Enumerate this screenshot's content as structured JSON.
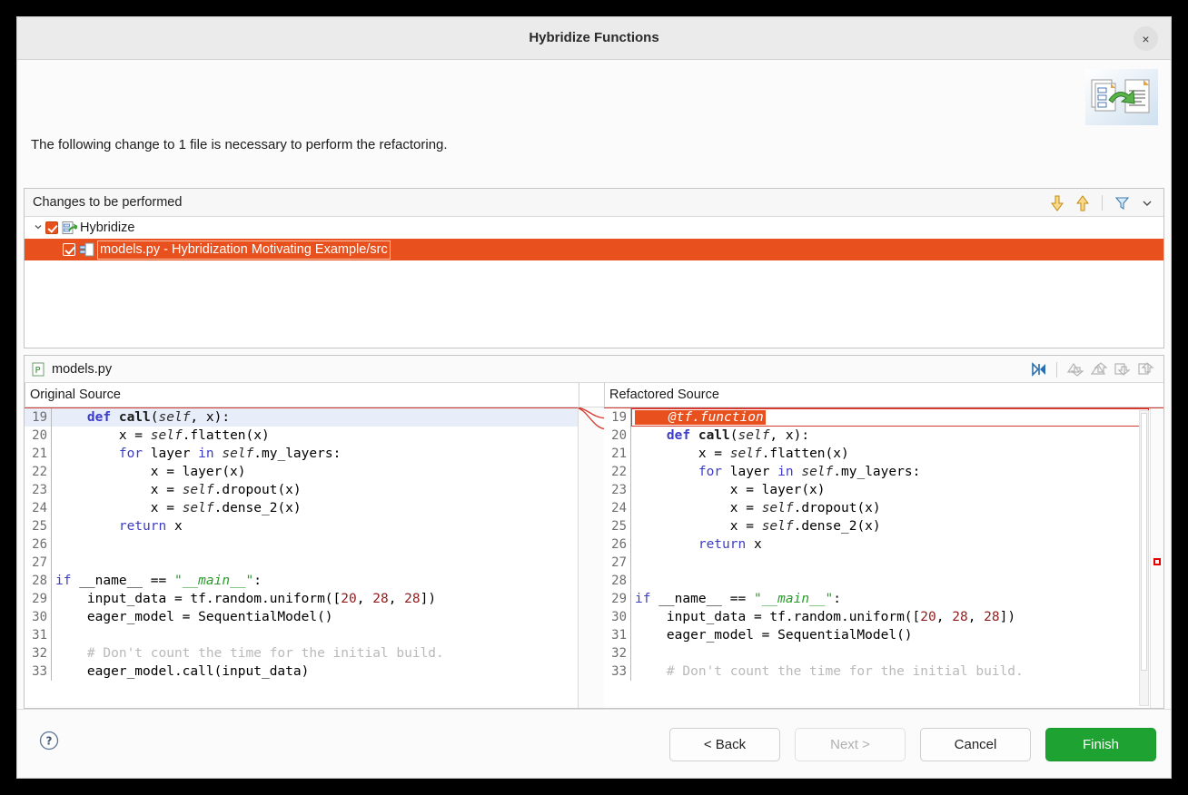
{
  "window": {
    "title": "Hybridize Functions",
    "close_label": "×",
    "banner_icon": "refactoring-banner-icon"
  },
  "intro": {
    "text": "The following change to 1 file is necessary to perform the refactoring."
  },
  "changes": {
    "title": "Changes to be performed",
    "toolbar": [
      {
        "name": "next-change-icon",
        "label": "⇓"
      },
      {
        "name": "previous-change-icon",
        "label": "⇑"
      },
      {
        "name": "filter-icon",
        "label": "filter"
      },
      {
        "name": "chevron-down-icon",
        "label": "⌄"
      }
    ],
    "tree": [
      {
        "label": "Hybridize",
        "checked": true,
        "expanded": true,
        "twisty": "⌄",
        "icon": "refactoring-change-icon"
      },
      {
        "label": "models.py - Hybridization Motivating Example/src",
        "checked": true,
        "selected": true,
        "icon": "compare-file-change-icon"
      }
    ]
  },
  "compare": {
    "file_name": "models.py",
    "file_icon": "python-file-icon",
    "toolbar": [
      {
        "name": "switch-compare-viewer-icon",
        "label": "swap"
      },
      {
        "name": "copy-all-left-to-right-icon",
        "label": "copy-all-lr"
      },
      {
        "name": "copy-all-right-to-left-icon",
        "label": "copy-all-rl"
      },
      {
        "name": "copy-current-left-to-right-icon",
        "label": "copy-cur-lr"
      },
      {
        "name": "copy-current-right-to-left-icon",
        "label": "copy-cur-rl"
      }
    ],
    "left_title": "Original Source",
    "right_title": "Refactored Source",
    "left_lines": [
      {
        "n": "19",
        "highlight": true,
        "segs": [
          {
            "t": "    ",
            "c": ""
          },
          {
            "t": "def ",
            "c": "kw"
          },
          {
            "t": "call",
            "c": "fn"
          },
          {
            "t": "(",
            "c": ""
          },
          {
            "t": "self",
            "c": "slf"
          },
          {
            "t": ", x):",
            "c": ""
          }
        ]
      },
      {
        "n": "20",
        "segs": [
          {
            "t": "        x = ",
            "c": ""
          },
          {
            "t": "self",
            "c": "slf"
          },
          {
            "t": ".flatten(x)",
            "c": ""
          }
        ]
      },
      {
        "n": "21",
        "segs": [
          {
            "t": "        ",
            "c": ""
          },
          {
            "t": "for",
            "c": "kw2"
          },
          {
            "t": " layer ",
            "c": ""
          },
          {
            "t": "in",
            "c": "kw2"
          },
          {
            "t": " ",
            "c": ""
          },
          {
            "t": "self",
            "c": "slf"
          },
          {
            "t": ".my_layers:",
            "c": ""
          }
        ]
      },
      {
        "n": "22",
        "segs": [
          {
            "t": "            x = layer(x)",
            "c": ""
          }
        ]
      },
      {
        "n": "23",
        "segs": [
          {
            "t": "            x = ",
            "c": ""
          },
          {
            "t": "self",
            "c": "slf"
          },
          {
            "t": ".dropout(x)",
            "c": ""
          }
        ]
      },
      {
        "n": "24",
        "segs": [
          {
            "t": "            x = ",
            "c": ""
          },
          {
            "t": "self",
            "c": "slf"
          },
          {
            "t": ".dense_2(x)",
            "c": ""
          }
        ]
      },
      {
        "n": "25",
        "segs": [
          {
            "t": "        ",
            "c": ""
          },
          {
            "t": "return",
            "c": "kw2"
          },
          {
            "t": " x",
            "c": ""
          }
        ]
      },
      {
        "n": "26",
        "segs": [
          {
            "t": "",
            "c": ""
          }
        ]
      },
      {
        "n": "27",
        "segs": [
          {
            "t": "",
            "c": ""
          }
        ]
      },
      {
        "n": "28",
        "segs": [
          {
            "t": "if",
            "c": "kw2"
          },
          {
            "t": " __name__ == ",
            "c": ""
          },
          {
            "t": "\"",
            "c": "str"
          },
          {
            "t": "__main__",
            "c": "stri"
          },
          {
            "t": "\"",
            "c": "str"
          },
          {
            "t": ":",
            "c": ""
          }
        ]
      },
      {
        "n": "29",
        "segs": [
          {
            "t": "    input_data = tf.random.uniform([",
            "c": ""
          },
          {
            "t": "20",
            "c": "num"
          },
          {
            "t": ", ",
            "c": ""
          },
          {
            "t": "28",
            "c": "num"
          },
          {
            "t": ", ",
            "c": ""
          },
          {
            "t": "28",
            "c": "num"
          },
          {
            "t": "])",
            "c": ""
          }
        ]
      },
      {
        "n": "30",
        "segs": [
          {
            "t": "    eager_model = SequentialModel()",
            "c": ""
          }
        ]
      },
      {
        "n": "31",
        "segs": [
          {
            "t": "",
            "c": ""
          }
        ]
      },
      {
        "n": "32",
        "segs": [
          {
            "t": "    # Don't count the time for the initial build.",
            "c": "cmt"
          }
        ]
      },
      {
        "n": "33",
        "segs": [
          {
            "t": "    eager_model.call(input_data)",
            "c": ""
          }
        ]
      }
    ],
    "right_lines": [
      {
        "n": "19",
        "diff": true,
        "diff_text": "@tf.function",
        "segs": []
      },
      {
        "n": "20",
        "segs": [
          {
            "t": "    ",
            "c": ""
          },
          {
            "t": "def ",
            "c": "kw"
          },
          {
            "t": "call",
            "c": "fn"
          },
          {
            "t": "(",
            "c": ""
          },
          {
            "t": "self",
            "c": "slf"
          },
          {
            "t": ", x):",
            "c": ""
          }
        ]
      },
      {
        "n": "21",
        "segs": [
          {
            "t": "        x = ",
            "c": ""
          },
          {
            "t": "self",
            "c": "slf"
          },
          {
            "t": ".flatten(x)",
            "c": ""
          }
        ]
      },
      {
        "n": "22",
        "segs": [
          {
            "t": "        ",
            "c": ""
          },
          {
            "t": "for",
            "c": "kw2"
          },
          {
            "t": " layer ",
            "c": ""
          },
          {
            "t": "in",
            "c": "kw2"
          },
          {
            "t": " ",
            "c": ""
          },
          {
            "t": "self",
            "c": "slf"
          },
          {
            "t": ".my_layers:",
            "c": ""
          }
        ]
      },
      {
        "n": "23",
        "segs": [
          {
            "t": "            x = layer(x)",
            "c": ""
          }
        ]
      },
      {
        "n": "24",
        "segs": [
          {
            "t": "            x = ",
            "c": ""
          },
          {
            "t": "self",
            "c": "slf"
          },
          {
            "t": ".dropout(x)",
            "c": ""
          }
        ]
      },
      {
        "n": "25",
        "segs": [
          {
            "t": "            x = ",
            "c": ""
          },
          {
            "t": "self",
            "c": "slf"
          },
          {
            "t": ".dense_2(x)",
            "c": ""
          }
        ]
      },
      {
        "n": "26",
        "segs": [
          {
            "t": "        ",
            "c": ""
          },
          {
            "t": "return",
            "c": "kw2"
          },
          {
            "t": " x",
            "c": ""
          }
        ]
      },
      {
        "n": "27",
        "segs": [
          {
            "t": "",
            "c": ""
          }
        ]
      },
      {
        "n": "28",
        "segs": [
          {
            "t": "",
            "c": ""
          }
        ]
      },
      {
        "n": "29",
        "segs": [
          {
            "t": "if",
            "c": "kw2"
          },
          {
            "t": " __name__ == ",
            "c": ""
          },
          {
            "t": "\"",
            "c": "str"
          },
          {
            "t": "__main__",
            "c": "stri"
          },
          {
            "t": "\"",
            "c": "str"
          },
          {
            "t": ":",
            "c": ""
          }
        ]
      },
      {
        "n": "30",
        "segs": [
          {
            "t": "    input_data = tf.random.uniform([",
            "c": ""
          },
          {
            "t": "20",
            "c": "num"
          },
          {
            "t": ", ",
            "c": ""
          },
          {
            "t": "28",
            "c": "num"
          },
          {
            "t": ", ",
            "c": ""
          },
          {
            "t": "28",
            "c": "num"
          },
          {
            "t": "])",
            "c": ""
          }
        ]
      },
      {
        "n": "31",
        "segs": [
          {
            "t": "    eager_model = SequentialModel()",
            "c": ""
          }
        ]
      },
      {
        "n": "32",
        "segs": [
          {
            "t": "",
            "c": ""
          }
        ]
      },
      {
        "n": "33",
        "segs": [
          {
            "t": "    # Don't count the time for the initial build.",
            "c": "cmt"
          }
        ]
      }
    ]
  },
  "footer": {
    "help_label": "?",
    "buttons": [
      {
        "name": "back-button",
        "label": "< Back",
        "disabled": false,
        "primary": false
      },
      {
        "name": "next-button",
        "label": "Next >",
        "disabled": true,
        "primary": false
      },
      {
        "name": "cancel-button",
        "label": "Cancel",
        "disabled": false,
        "primary": false
      },
      {
        "name": "finish-button",
        "label": "Finish",
        "disabled": false,
        "primary": true
      }
    ]
  },
  "colors": {
    "selection_orange": "#e8501e",
    "diff_red": "#d53b30",
    "finish_green": "#1ea332",
    "titlebar": "#ebebeb"
  }
}
